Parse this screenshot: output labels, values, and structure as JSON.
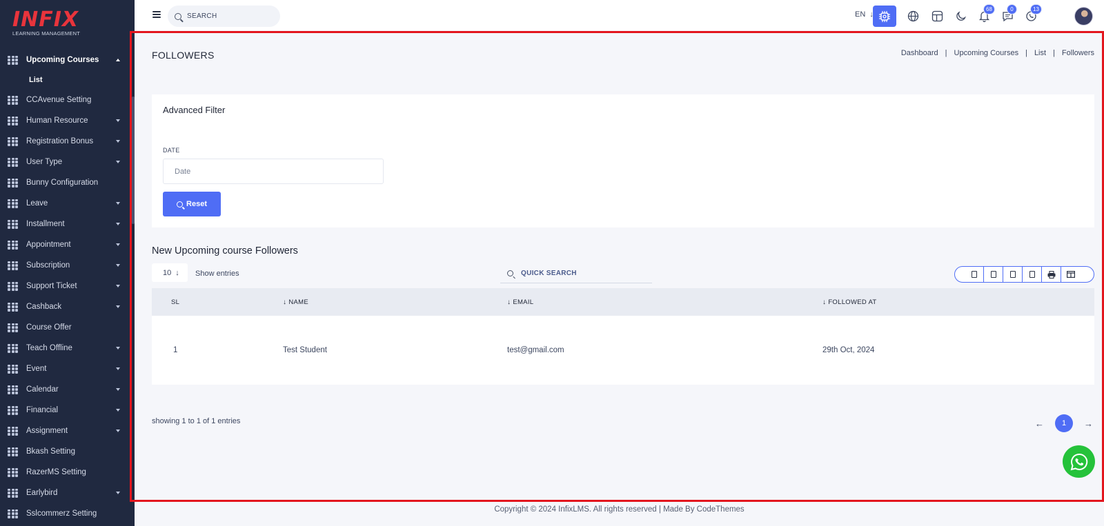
{
  "logo": {
    "main": "INFIX",
    "sub": "LEARNING MANAGEMENT"
  },
  "sidebar": {
    "items": [
      {
        "label": "Upcoming Courses",
        "expanded": true,
        "active": true
      },
      {
        "label": "List",
        "submenu": true
      },
      {
        "label": "CCAvenue Setting"
      },
      {
        "label": "Human Resource",
        "caret": true
      },
      {
        "label": "Registration Bonus",
        "caret": true
      },
      {
        "label": "User Type",
        "caret": true
      },
      {
        "label": "Bunny Configuration"
      },
      {
        "label": "Leave",
        "caret": true
      },
      {
        "label": "Installment",
        "caret": true
      },
      {
        "label": "Appointment",
        "caret": true
      },
      {
        "label": "Subscription",
        "caret": true
      },
      {
        "label": "Support Ticket",
        "caret": true
      },
      {
        "label": "Cashback",
        "caret": true
      },
      {
        "label": "Course Offer"
      },
      {
        "label": "Teach Offline",
        "caret": true
      },
      {
        "label": "Event",
        "caret": true
      },
      {
        "label": "Calendar",
        "caret": true
      },
      {
        "label": "Financial",
        "caret": true
      },
      {
        "label": "Assignment",
        "caret": true
      },
      {
        "label": "Bkash Setting"
      },
      {
        "label": "RazerMS Setting"
      },
      {
        "label": "Earlybird",
        "caret": true
      },
      {
        "label": "Sslcommerz Setting"
      }
    ]
  },
  "header": {
    "search_placeholder": "SEARCH",
    "language": "EN",
    "notifications_count": "68",
    "messages_count": "0",
    "calls_count": "13"
  },
  "page": {
    "title": "FOLLOWERS",
    "breadcrumb": [
      "Dashboard",
      "Upcoming Courses",
      "List",
      "Followers"
    ]
  },
  "filter": {
    "title": "Advanced Filter",
    "date_label": "DATE",
    "date_placeholder": "Date",
    "reset_label": "Reset"
  },
  "table_section": {
    "title": "New Upcoming course Followers",
    "entries_value": "10",
    "show_entries_label": "Show entries",
    "quick_search_placeholder": "QUICK SEARCH",
    "columns": [
      "SL",
      "NAME",
      "EMAIL",
      "FOLLOWED AT"
    ],
    "rows": [
      {
        "sl": "1",
        "name": "Test Student",
        "email": "test@gmail.com",
        "followed_at": "29th Oct, 2024"
      }
    ],
    "showing_text": "showing 1 to 1 of 1 entries",
    "current_page": "1"
  },
  "footer": {
    "text": "Copyright © 2024 InfixLMS. All rights reserved | Made By CodeThemes"
  },
  "colors": {
    "sidebar_bg": "#202940",
    "accent": "#4f6df5",
    "logo_red": "#e8343c",
    "frame_red": "#e3161e",
    "whatsapp": "#25c23a"
  }
}
